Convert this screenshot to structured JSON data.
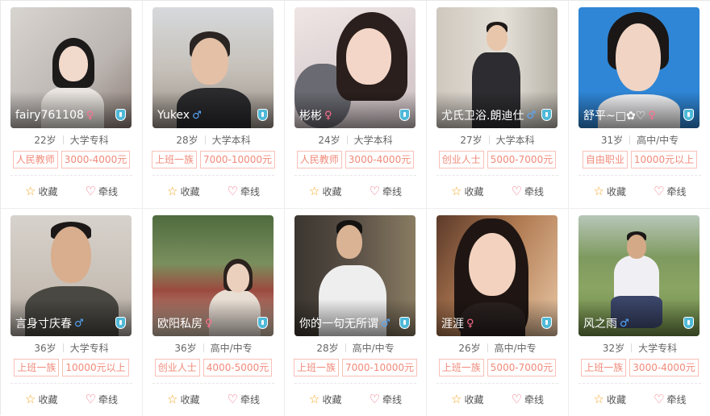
{
  "actions": {
    "favorite_label": "收藏",
    "match_label": "牵线"
  },
  "icons": {
    "favorite": "star-outline-icon",
    "match": "heart-outline-icon",
    "verified": "verified-shield-icon",
    "female": "female-symbol-icon",
    "male": "male-symbol-icon"
  },
  "colors": {
    "tag_border": "#f7c0b8",
    "tag_text": "#f08a7a",
    "female": "#ff6f8e",
    "male": "#55a9ff",
    "star": "#f5a623",
    "heart": "#f0647a"
  },
  "profiles": [
    {
      "nickname": "fairy761108",
      "gender": "female",
      "gender_symbol": "♀",
      "age": "22岁",
      "education": "大学专科",
      "occupation": "人民教师",
      "income": "3000-4000元"
    },
    {
      "nickname": "Yukex",
      "gender": "male",
      "gender_symbol": "♂",
      "age": "28岁",
      "education": "大学本科",
      "occupation": "上班一族",
      "income": "7000-10000元"
    },
    {
      "nickname": "彬彬",
      "gender": "female",
      "gender_symbol": "♀",
      "age": "24岁",
      "education": "大学本科",
      "occupation": "人民教师",
      "income": "3000-4000元"
    },
    {
      "nickname": "尤氏卫浴.朗迪仕",
      "gender": "male",
      "gender_symbol": "♂",
      "age": "27岁",
      "education": "大学本科",
      "occupation": "创业人士",
      "income": "5000-7000元"
    },
    {
      "nickname": "舒平~□✿♡",
      "gender": "female",
      "gender_symbol": "♀",
      "age": "31岁",
      "education": "高中/中专",
      "occupation": "自由职业",
      "income": "10000元以上"
    },
    {
      "nickname": "言身寸庆春",
      "gender": "male",
      "gender_symbol": "♂",
      "age": "36岁",
      "education": "大学专科",
      "occupation": "上班一族",
      "income": "10000元以上"
    },
    {
      "nickname": "欧阳私房",
      "gender": "female",
      "gender_symbol": "♀",
      "age": "36岁",
      "education": "高中/中专",
      "occupation": "创业人士",
      "income": "4000-5000元"
    },
    {
      "nickname": "你的一句无所谓",
      "gender": "male",
      "gender_symbol": "♂",
      "age": "28岁",
      "education": "高中/中专",
      "occupation": "上班一族",
      "income": "7000-10000元"
    },
    {
      "nickname": "涯涯",
      "gender": "female",
      "gender_symbol": "♀",
      "age": "26岁",
      "education": "高中/中专",
      "occupation": "上班一族",
      "income": "5000-7000元"
    },
    {
      "nickname": "风之雨",
      "gender": "male",
      "gender_symbol": "♂",
      "age": "32岁",
      "education": "大学专科",
      "occupation": "上班一族",
      "income": "3000-4000元"
    }
  ]
}
